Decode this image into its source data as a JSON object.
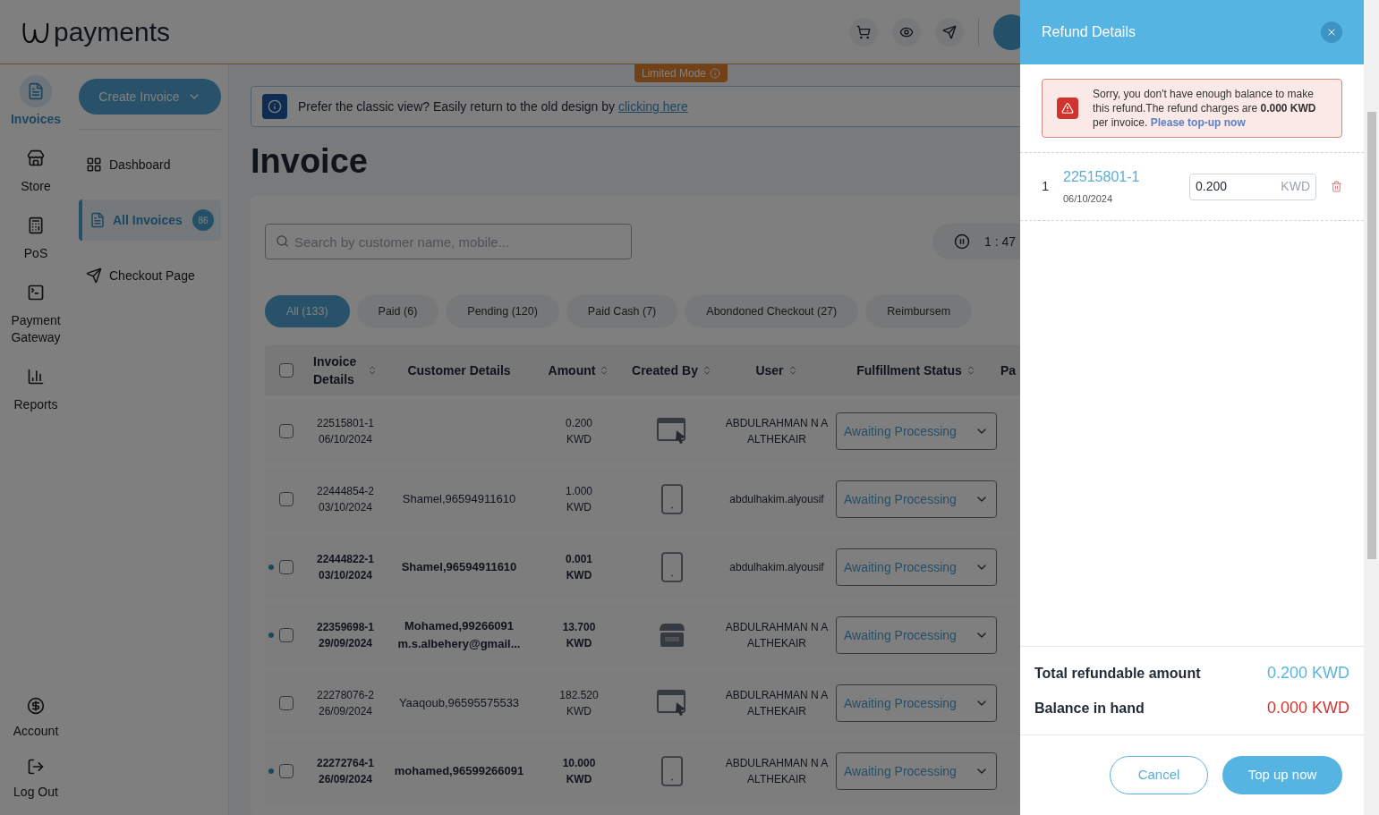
{
  "header": {
    "logo": "payments",
    "limited_mode": "Limited Mode"
  },
  "rail": [
    {
      "kind": "invoices",
      "label": "Invoices",
      "selected": true
    },
    {
      "kind": "store",
      "label": "Store",
      "selected": false
    },
    {
      "kind": "pos",
      "label": "PoS",
      "selected": false
    },
    {
      "kind": "gateway",
      "label": "Payment Gateway",
      "selected": false
    },
    {
      "kind": "reports",
      "label": "Reports",
      "selected": false
    }
  ],
  "rail_bottom": [
    {
      "kind": "account",
      "label": "Account"
    },
    {
      "kind": "logout",
      "label": "Log Out"
    }
  ],
  "submenu": {
    "create_button": "Create Invoice",
    "items": [
      {
        "kind": "dashboard",
        "label": "Dashboard",
        "selected": false
      },
      {
        "kind": "invoices",
        "label": "All Invoices",
        "badge": "86",
        "selected": true
      },
      {
        "kind": "checkout",
        "label": "Checkout Page",
        "selected": false
      }
    ]
  },
  "banner": {
    "text": "Prefer the classic view? Easily return to the old design by",
    "link": "clicking here"
  },
  "page_title": "Invoice",
  "search": {
    "placeholder": "Search by customer name, mobile..."
  },
  "timer": "1 : 47",
  "filters": [
    {
      "label": "All (133)",
      "selected": true
    },
    {
      "label": "Paid (6)",
      "selected": false
    },
    {
      "label": "Pending (120)",
      "selected": false
    },
    {
      "label": "Paid Cash (7)",
      "selected": false
    },
    {
      "label": "Abondoned Checkout (27)",
      "selected": false
    },
    {
      "label": "Reimbursem",
      "selected": false
    }
  ],
  "table": {
    "select_all": {
      "checked": false
    },
    "columns": [
      {
        "label": "Invoice Details",
        "sortable": true
      },
      {
        "label": "Customer Details",
        "sortable": false
      },
      {
        "label": "Amount",
        "sortable": true
      },
      {
        "label": "Created By",
        "sortable": true
      },
      {
        "label": "User",
        "sortable": true
      },
      {
        "label": "Fulfillment Status",
        "sortable": true
      },
      {
        "label": "Pa"
      }
    ],
    "rows": [
      {
        "unread": false,
        "checked": false,
        "invoice": "22515801-1",
        "date": "06/10/2024",
        "amount": "0.200",
        "currency": "KWD",
        "kind": "web",
        "user": "ABDULRAHMAN N A ALTHEKAIR",
        "status": "Awaiting Processing"
      },
      {
        "unread": false,
        "checked": false,
        "invoice": "22444854-2",
        "date": "03/10/2024",
        "customer": [
          "Shamel,96594911610"
        ],
        "amount": "1.000",
        "currency": "KWD",
        "kind": "mobile",
        "user": "abdulhakim.alyousif",
        "status": "Awaiting Processing"
      },
      {
        "unread": true,
        "checked": false,
        "invoice": "22444822-1",
        "date": "03/10/2024",
        "customer": [
          "Shamel,96594911610"
        ],
        "amount": "0.001",
        "currency": "KWD",
        "kind": "mobile",
        "user": "abdulhakim.alyousif",
        "status": "Awaiting Processing"
      },
      {
        "unread": true,
        "checked": false,
        "invoice": "22359698-1",
        "date": "29/09/2024",
        "customer": [
          "Mohamed,99266091",
          "m.s.albehery@gmail..."
        ],
        "amount": "13.700",
        "currency": "KWD",
        "kind": "store",
        "user": "ABDULRAHMAN N A ALTHEKAIR",
        "status": "Awaiting Processing"
      },
      {
        "unread": false,
        "checked": false,
        "invoice": "22278076-2",
        "date": "26/09/2024",
        "customer": [
          "Yaaqoub,96595575533"
        ],
        "amount": "182.520",
        "currency": "KWD",
        "kind": "web",
        "user": "ABDULRAHMAN N A ALTHEKAIR",
        "status": "Awaiting Processing"
      },
      {
        "unread": true,
        "checked": false,
        "invoice": "22272764-1",
        "date": "26/09/2024",
        "customer": [
          "mohamed,96599266091"
        ],
        "amount": "10.000",
        "currency": "KWD",
        "kind": "mobile",
        "user": "ABDULRAHMAN N A ALTHEKAIR",
        "status": "Awaiting Processing"
      }
    ]
  },
  "drawer": {
    "title": "Refund Details",
    "alert": {
      "text": "Sorry, you don't have enough balance to make this refund.The refund charges are **0.000 KWD** per invoice.",
      "link": "Please top-up now"
    },
    "items": [
      {
        "index": "1",
        "invoice": "22515801-1",
        "date": "06/10/2024",
        "amount": "0.200",
        "currency": "KWD"
      }
    ],
    "totals": [
      {
        "label": "Total refundable amount",
        "value": "0.200 KWD",
        "color": "#5ab4dc"
      },
      {
        "label": "Balance in hand",
        "value": "0.000 KWD",
        "color": "#d0342c"
      }
    ],
    "cancel": "Cancel",
    "confirm": "Top up now"
  }
}
